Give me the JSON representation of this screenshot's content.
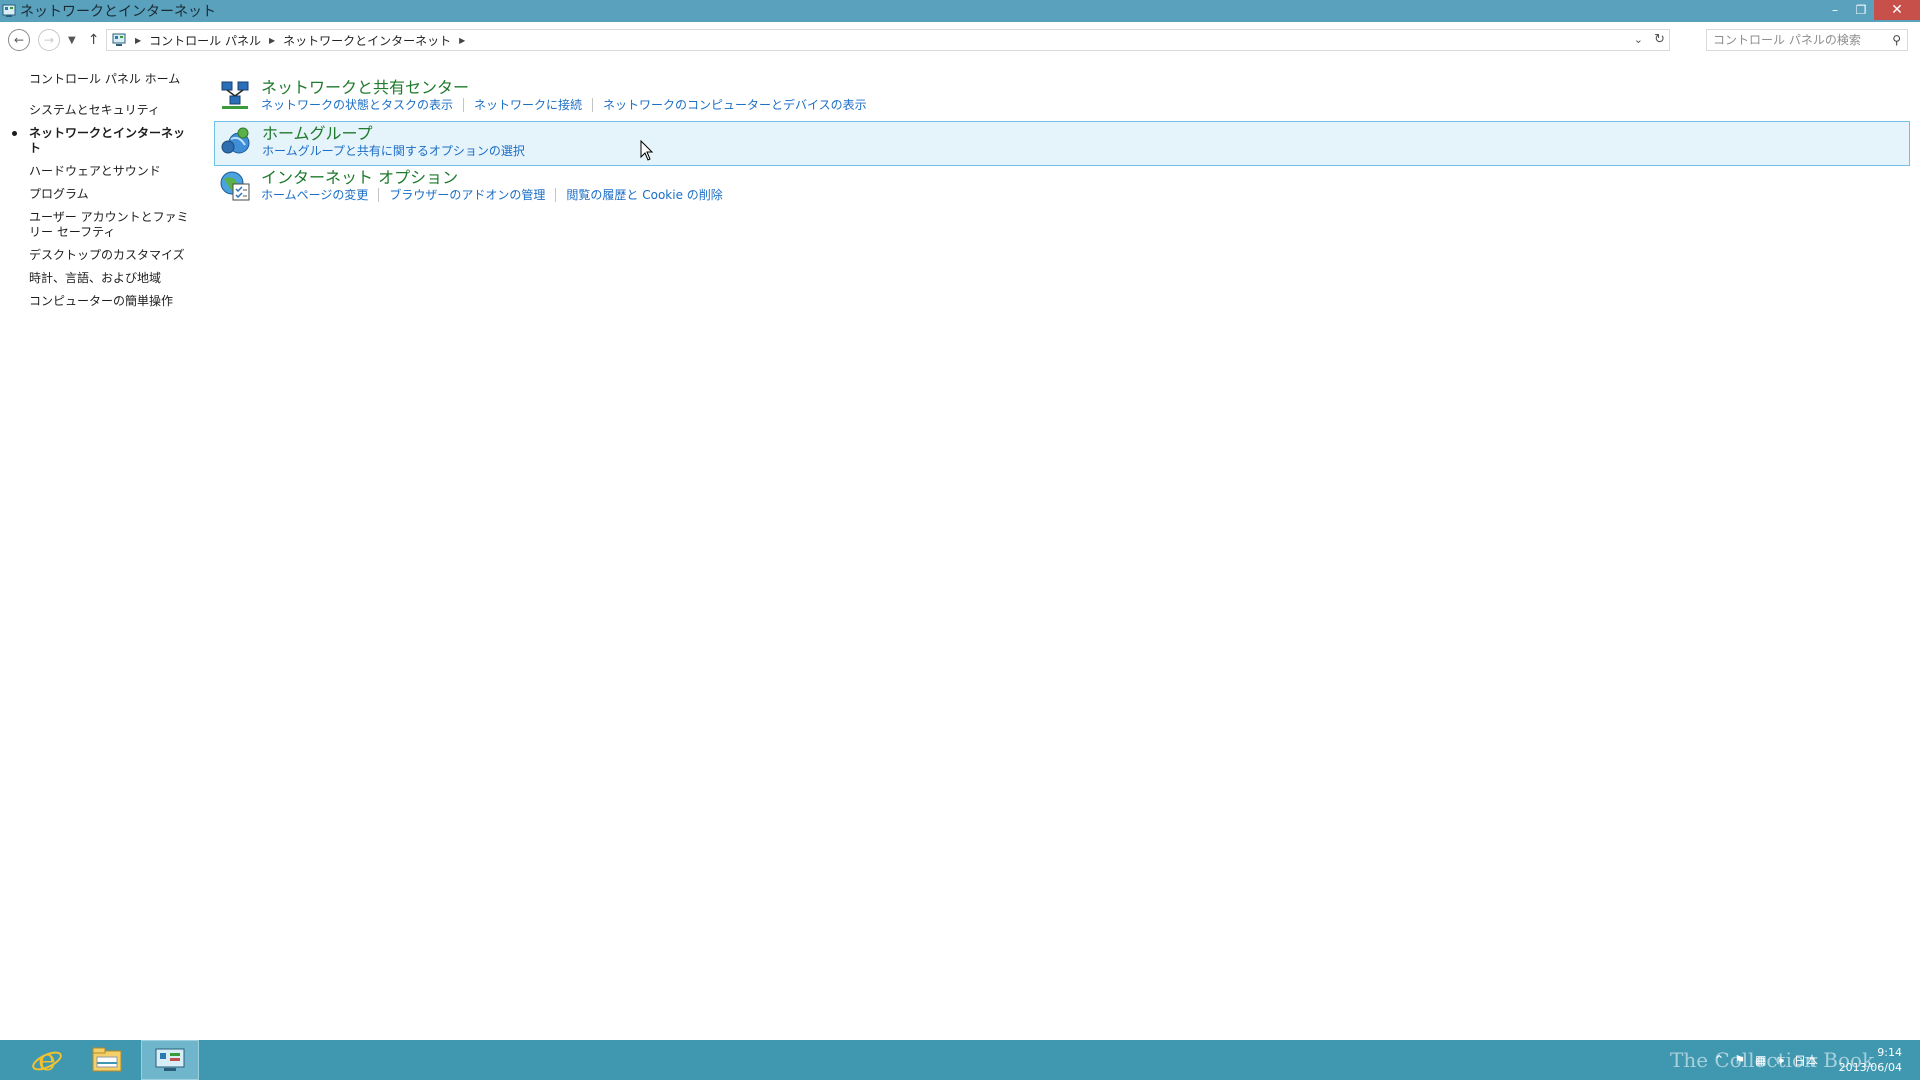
{
  "window": {
    "title": "ネットワークとインターネット",
    "controls": {
      "minimize": "–",
      "restore": "❐",
      "close": "✕"
    }
  },
  "address": {
    "back_icon": "arrow-left-icon",
    "forward_icon": "arrow-right-icon",
    "recent_icon": "chevron-down-icon",
    "up_icon": "arrow-up-icon",
    "breadcrumbs": [
      "コントロール パネル",
      "ネットワークとインターネット"
    ],
    "search_placeholder": "コントロール パネルの検索"
  },
  "sidebar": {
    "home": "コントロール パネル ホーム",
    "items": [
      {
        "label": "システムとセキュリティ",
        "active": false
      },
      {
        "label": "ネットワークとインターネット",
        "active": true
      },
      {
        "label": "ハードウェアとサウンド",
        "active": false
      },
      {
        "label": "プログラム",
        "active": false
      },
      {
        "label": "ユーザー アカウントとファミリー セーフティ",
        "active": false
      },
      {
        "label": "デスクトップのカスタマイズ",
        "active": false
      },
      {
        "label": "時計、言語、および地域",
        "active": false
      },
      {
        "label": "コンピューターの簡単操作",
        "active": false
      }
    ]
  },
  "categories": [
    {
      "title": "ネットワークと共有センター",
      "icon": "network-sharing-center-icon",
      "links": [
        "ネットワークの状態とタスクの表示",
        "ネットワークに接続",
        "ネットワークのコンピューターとデバイスの表示"
      ]
    },
    {
      "title": "ホームグループ",
      "icon": "homegroup-icon",
      "links": [
        "ホームグループと共有に関するオプションの選択"
      ]
    },
    {
      "title": "インターネット オプション",
      "icon": "internet-options-icon",
      "links": [
        "ホームページの変更",
        "ブラウザーのアドオンの管理",
        "閲覧の履歴と Cookie の削除"
      ]
    }
  ],
  "taskbar": {
    "apps": [
      "internet-explorer-icon",
      "file-explorer-icon",
      "control-panel-icon"
    ],
    "tray": {
      "language": "日本",
      "time": "9:14",
      "date": "2013/06/04"
    },
    "watermark": "The Collection Book"
  },
  "colors": {
    "titlebar": "#5aa1bd",
    "taskbar": "#3f97b0",
    "category_title": "#1e7a2c",
    "link": "#1b6ec6",
    "hover_bg": "#e5f3fb",
    "hover_border": "#70c0e7",
    "close_button": "#c7504b"
  }
}
